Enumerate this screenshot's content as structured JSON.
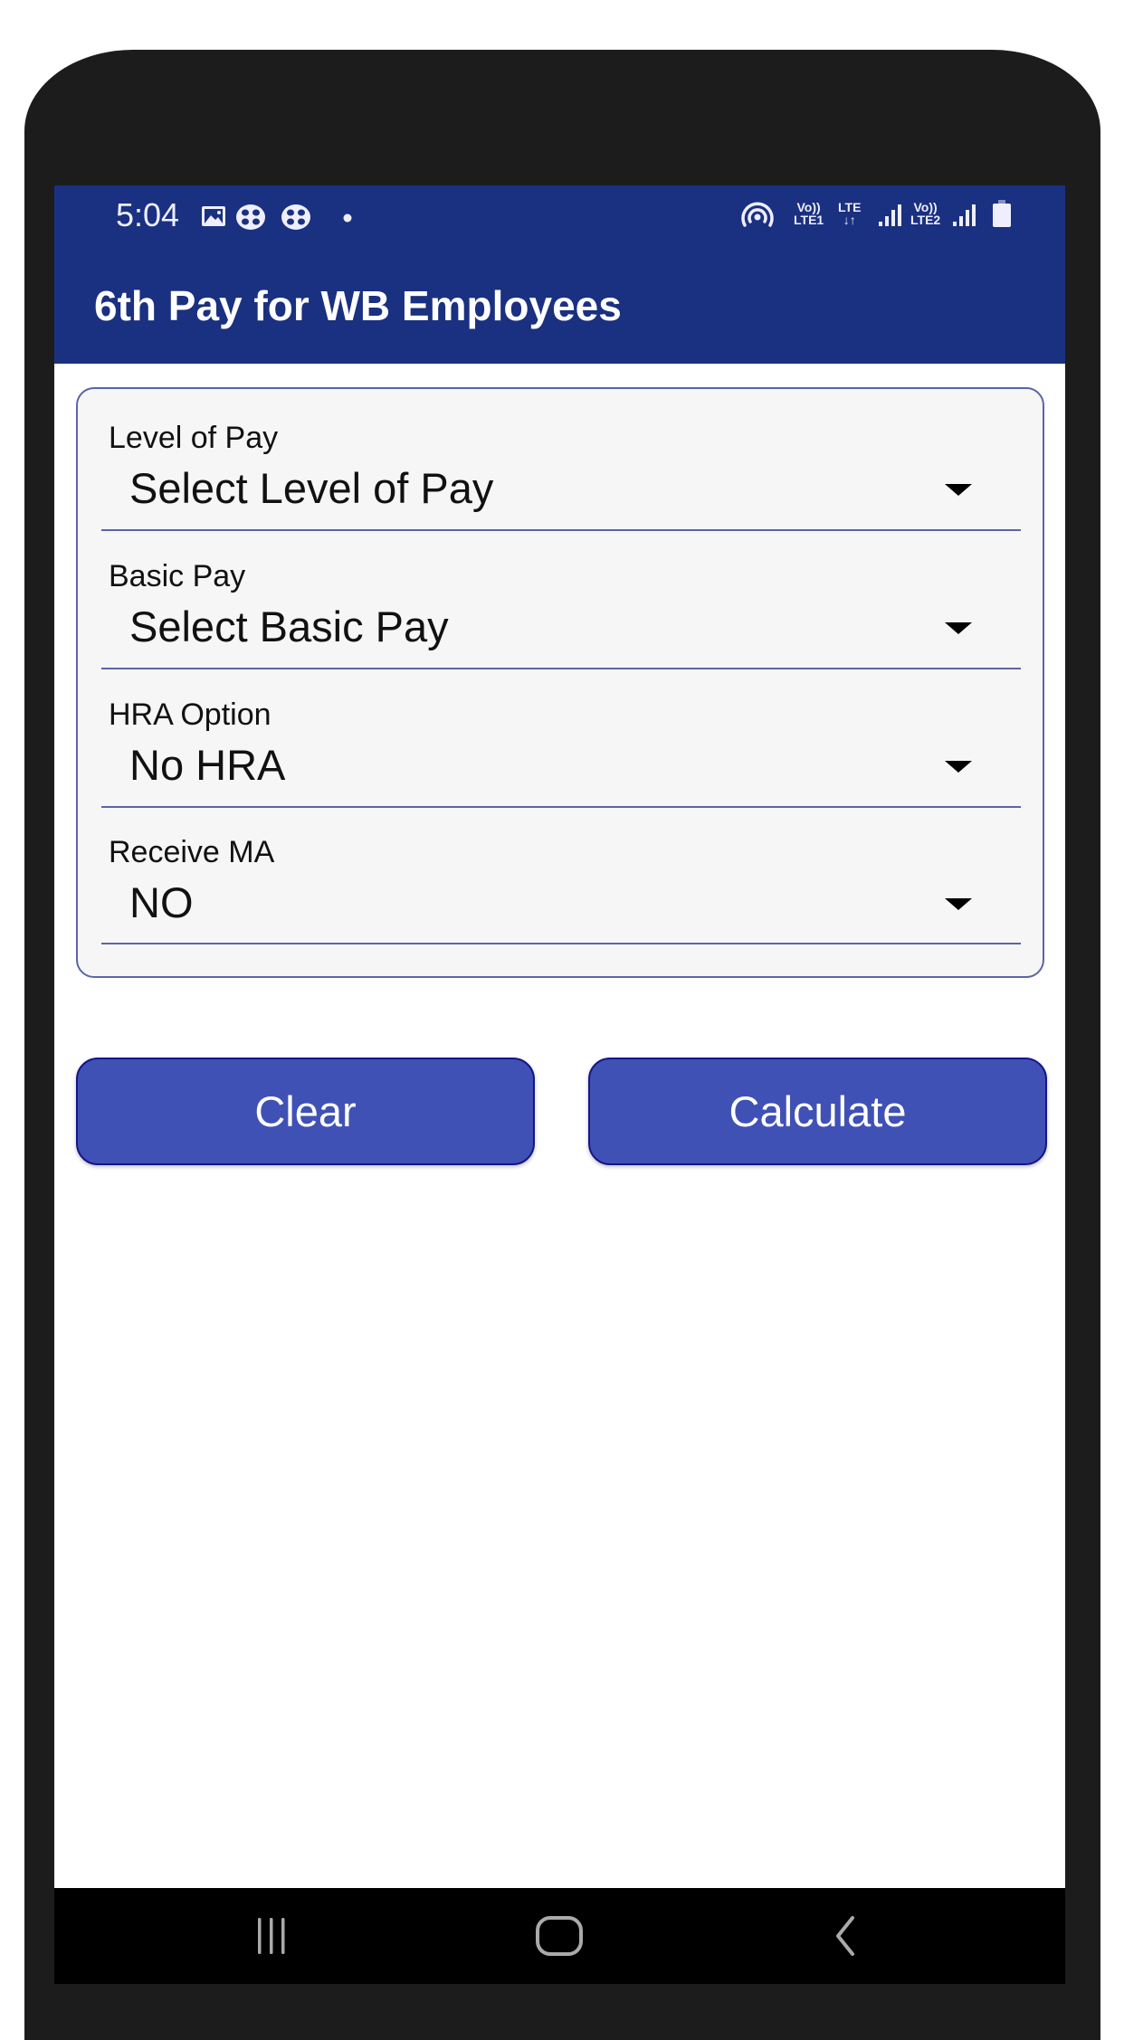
{
  "status_bar": {
    "time": "5:04",
    "left_icons": [
      "gallery-icon",
      "app-notification-icon",
      "app-notification-icon",
      "more-notifications-dot-icon"
    ],
    "right_icons": [
      "hotspot-icon",
      "volte-lte1-icon",
      "lte-data-icon",
      "signal-sim1-icon",
      "volte-lte2-icon",
      "signal-sim2-icon",
      "battery-icon"
    ],
    "volte1_top": "Vo))",
    "volte1_bottom": "LTE1",
    "lte_top": "LTE",
    "lte_bottom": "↓↑",
    "volte2_top": "Vo))",
    "volte2_bottom": "LTE2"
  },
  "app_bar": {
    "title": "6th Pay for WB Employees"
  },
  "form": {
    "fields": [
      {
        "label": "Level of Pay",
        "value": "Select Level of Pay"
      },
      {
        "label": "Basic Pay",
        "value": "Select Basic Pay"
      },
      {
        "label": "HRA Option",
        "value": "No HRA"
      },
      {
        "label": "Receive MA",
        "value": "NO"
      }
    ]
  },
  "buttons": {
    "clear": "Clear",
    "calculate": "Calculate"
  },
  "nav_bar": {
    "items": [
      "recent-apps",
      "home",
      "back"
    ]
  },
  "colors": {
    "primary": "#1a3080",
    "button": "#4051b5",
    "button_border": "#15158a",
    "card_border": "#5a65a8",
    "card_bg": "#f6f6f6"
  }
}
